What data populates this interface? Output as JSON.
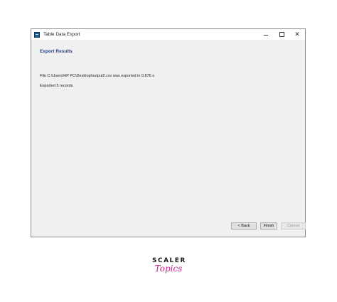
{
  "window": {
    "title": "Table Data Export",
    "controls": {
      "minimize": "minimize",
      "maximize": "maximize",
      "close": "✕"
    }
  },
  "content": {
    "section_title": "Export Results",
    "message_file": "File C:\\Users\\HP PC\\Desktop\\output2.csv was exported in 0.876 s",
    "message_records": "Exported 5 records"
  },
  "buttons": {
    "back": "< Back",
    "finish": "Finish",
    "cancel": "Cancel"
  },
  "logo": {
    "top": "SCALER",
    "bottom": "Topics"
  },
  "colors": {
    "section_title": "#1f3e87",
    "logo_accent": "#c0268a"
  }
}
